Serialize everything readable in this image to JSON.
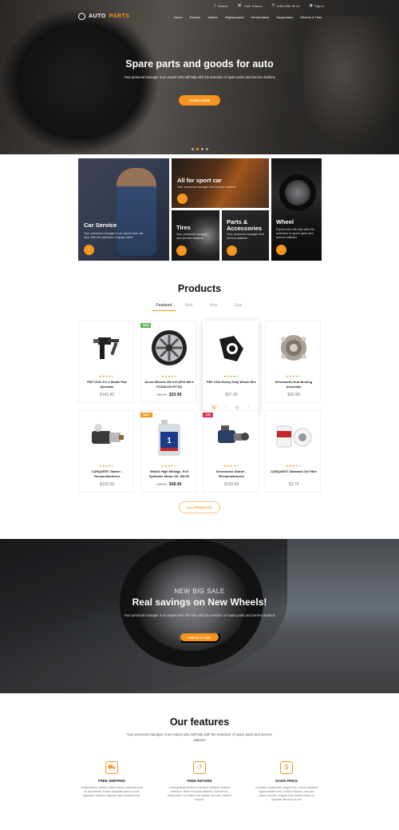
{
  "brand": {
    "name_a": "AUTO",
    "name_b": "PARTS"
  },
  "topbar": {
    "search": "Search",
    "cart": "Cart: 0 items",
    "phone": "8 800 555 55 43",
    "signin": "Sign in"
  },
  "nav": [
    "Home",
    "Exterior",
    "Interior",
    "Replacement",
    "Performance",
    "Suspension",
    "Wheels & Tires"
  ],
  "hero": {
    "title": "Spare parts and goods for auto",
    "subtitle": "Your personal manager is an expert who will help with the selection of spare parts and service stations",
    "button": "LEARN MORE",
    "slides": 4,
    "active_slide": 1
  },
  "categories": [
    {
      "title": "Car Service",
      "desc": "Your personal manager is an expert who will help with the selection of spare parts"
    },
    {
      "title": "All for sport car",
      "desc": "Your personal manager and service stations"
    },
    {
      "title": "Tires",
      "desc": "Your personal manager and service stations"
    },
    {
      "title": "Parts & Acceccories",
      "desc": "Your personal manager and service stations"
    },
    {
      "title": "Wheel",
      "desc": "Expert who will help with the selection of spare parts and service stations"
    }
  ],
  "products": {
    "title": "Products",
    "tabs": [
      "Featured",
      "Best",
      "New",
      "Sale"
    ],
    "active_tab": "Featured",
    "items": [
      {
        "name": "PBT USA 4 in 1 Brake Pad Spreader",
        "old": "",
        "price": "$142.99",
        "badge": "",
        "rating": 4,
        "icon": "brake-spreader-image"
      },
      {
        "name": "Acura Wheels 2W 213 (R15 W6.5 PCD5x120 ET15)",
        "old": "$35.99",
        "price": "$33.99",
        "badge": "NEW",
        "rating": 4,
        "icon": "alloy-wheel-image"
      },
      {
        "name": "PBT USA Heavy Duty Wrack Wre",
        "old": "",
        "price": "$97.49",
        "badge": "",
        "rating": 4,
        "icon": "socket-tool-image"
      },
      {
        "name": "Driveworks Hub Bearing Assembly",
        "old": "",
        "price": "$92.99",
        "badge": "",
        "rating": 4,
        "icon": "hub-bearing-image"
      },
      {
        "name": "CARQUEST Starter - Remanufactured",
        "old": "",
        "price": "$128.99",
        "badge": "",
        "rating": 4,
        "icon": "starter-image"
      },
      {
        "name": "Mobil1 High Mileage, Full Synthetic Motor Oil, 5W-30",
        "old": "$43.99",
        "price": "$38.99",
        "badge": "SALE",
        "rating": 4,
        "icon": "motor-oil-image"
      },
      {
        "name": "Driveworks Starter - Remanufactured",
        "old": "",
        "price": "$139.99",
        "badge": "-15%",
        "rating": 4,
        "icon": "starter-motor-image"
      },
      {
        "name": "CARQUEST Standard Oil Filter",
        "old": "",
        "price": "$3.79",
        "badge": "",
        "rating": 4,
        "icon": "oil-filter-image"
      }
    ],
    "all_button": "ALL PRODUCTS"
  },
  "banner": {
    "kicker": "NEW BIG SALE",
    "title": "Real savings on New Wheels!",
    "subtitle": "Your personal manager is an expert who will help with the selection of spare parts and service stations",
    "button": "CHECK IT OUT"
  },
  "features": {
    "title": "Our features",
    "subtitle": "Your personal manager is an expert who will help with the selection of spare parts and service stations",
    "items": [
      {
        "title": "FREE SHIPPING",
        "desc": "Suspendisse potenti. Etiam rutrum euismod urna eu accumsan. Fusce vulputate purus a velit dignissim ultrices. Aliquam eget eleifend erat.",
        "icon": "truck-icon"
      },
      {
        "title": "FREE RETURN",
        "desc": "Nulla gravida lectus eu tempus eleifend. Nullam interdum, libero id mollis eleifend, erat dui mo tellus enim, vel finibus est mauris vel nunc. Mauris dictum.",
        "icon": "return-icon"
      },
      {
        "title": "GOOD PRICE",
        "desc": "Curabitur consectetur augue nisi, viverra dapibus ligula sodales sed. Donec rhoncus, nisl non rutrum lobortis, magna eros mattis metus, ut egestas nisl arcu eu mi.",
        "icon": "price-tag-icon"
      }
    ]
  },
  "colors": {
    "accent": "#f7941d",
    "new_badge": "#5cb85c",
    "sale_badge": "#f7941d",
    "discount_badge": "#d9304f"
  }
}
